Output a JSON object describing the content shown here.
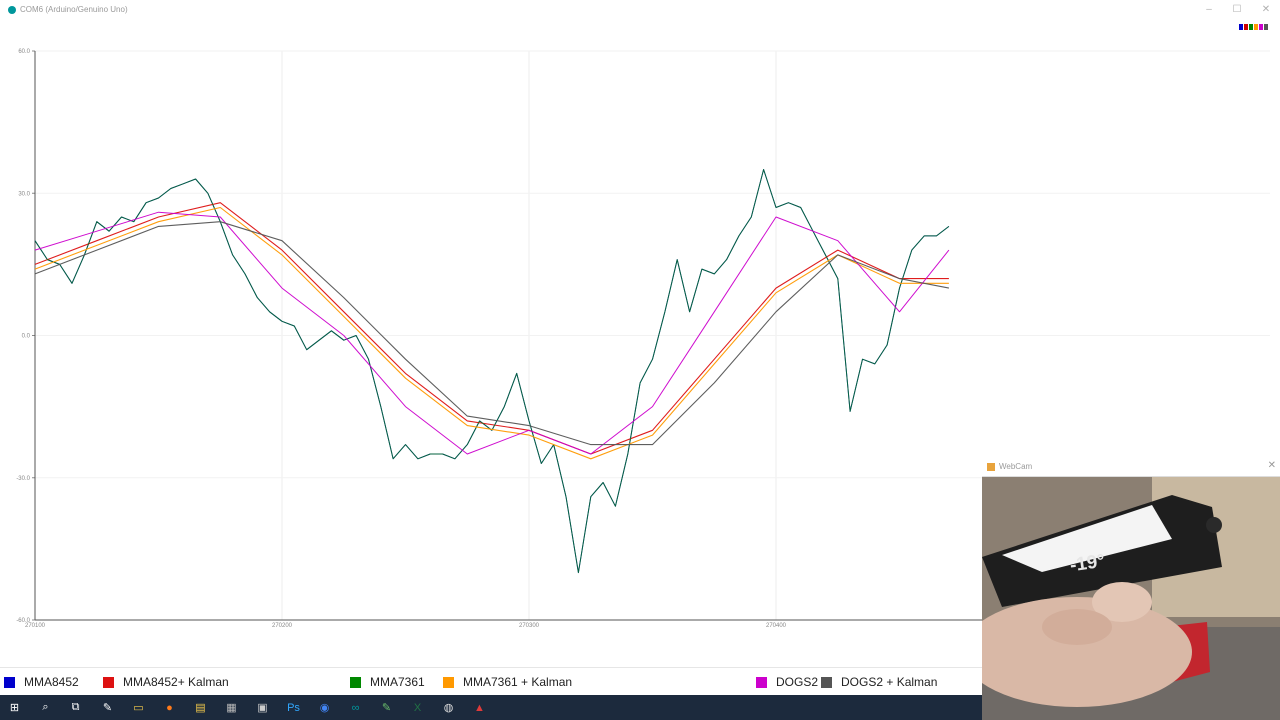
{
  "window": {
    "title": "COM6 (Arduino/Genuino Uno)",
    "controls": [
      "–",
      "☐",
      "✕"
    ]
  },
  "colorbar": [
    "#0000cc",
    "#cc0000",
    "#008800",
    "#ff9900",
    "#cc00cc",
    "#555555"
  ],
  "chart_data": {
    "type": "line",
    "ylim": [
      -60,
      60
    ],
    "y_ticks": [
      "60.0",
      "30.0",
      "0.0",
      "-30.0",
      "-60.0"
    ],
    "x_ticks": [
      "270100",
      "270200",
      "270300",
      "270400"
    ],
    "xlim": [
      270100,
      270600
    ],
    "grid": true,
    "legend_position": "bottom",
    "series": [
      {
        "name": "MMA8452",
        "color": "#0000cc",
        "points": [
          [
            270100,
            20
          ],
          [
            270105,
            16
          ],
          [
            270110,
            15
          ],
          [
            270115,
            11
          ],
          [
            270120,
            17
          ],
          [
            270125,
            24
          ],
          [
            270130,
            22
          ],
          [
            270135,
            25
          ],
          [
            270140,
            24
          ],
          [
            270145,
            28
          ],
          [
            270150,
            29
          ],
          [
            270155,
            31
          ],
          [
            270160,
            32
          ],
          [
            270165,
            33
          ],
          [
            270170,
            30
          ],
          [
            270175,
            24
          ],
          [
            270180,
            17
          ],
          [
            270185,
            13
          ],
          [
            270190,
            8
          ],
          [
            270195,
            5
          ],
          [
            270200,
            3
          ],
          [
            270205,
            2
          ],
          [
            270210,
            -3
          ],
          [
            270215,
            -1
          ],
          [
            270220,
            1
          ],
          [
            270225,
            -1
          ],
          [
            270230,
            0
          ],
          [
            270235,
            -5
          ],
          [
            270240,
            -15
          ],
          [
            270245,
            -26
          ],
          [
            270250,
            -23
          ],
          [
            270255,
            -26
          ],
          [
            270260,
            -25
          ],
          [
            270265,
            -25
          ],
          [
            270270,
            -26
          ],
          [
            270275,
            -23
          ],
          [
            270280,
            -18
          ],
          [
            270285,
            -20
          ],
          [
            270290,
            -15
          ],
          [
            270295,
            -8
          ],
          [
            270300,
            -18
          ],
          [
            270305,
            -27
          ],
          [
            270310,
            -23
          ],
          [
            270315,
            -34
          ],
          [
            270320,
            -50
          ],
          [
            270325,
            -34
          ],
          [
            270330,
            -31
          ],
          [
            270335,
            -36
          ],
          [
            270340,
            -25
          ],
          [
            270345,
            -10
          ],
          [
            270350,
            -5
          ],
          [
            270355,
            5
          ],
          [
            270360,
            16
          ],
          [
            270365,
            5
          ],
          [
            270370,
            14
          ],
          [
            270375,
            13
          ],
          [
            270380,
            16
          ],
          [
            270385,
            21
          ],
          [
            270390,
            25
          ],
          [
            270395,
            35
          ],
          [
            270400,
            27
          ],
          [
            270405,
            28
          ],
          [
            270410,
            27
          ],
          [
            270415,
            22
          ],
          [
            270420,
            17
          ],
          [
            270425,
            12
          ],
          [
            270430,
            -16
          ],
          [
            270435,
            -5
          ],
          [
            270440,
            -6
          ],
          [
            270445,
            -2
          ],
          [
            270450,
            10
          ],
          [
            270455,
            18
          ],
          [
            270460,
            21
          ],
          [
            270465,
            21
          ],
          [
            270470,
            23
          ]
        ]
      },
      {
        "name": "MMA8452+ Kalman",
        "color": "#dd1111",
        "points": [
          [
            270100,
            15
          ],
          [
            270125,
            20
          ],
          [
            270150,
            25
          ],
          [
            270175,
            28
          ],
          [
            270200,
            18
          ],
          [
            270225,
            5
          ],
          [
            270250,
            -8
          ],
          [
            270275,
            -18
          ],
          [
            270300,
            -20
          ],
          [
            270325,
            -25
          ],
          [
            270350,
            -20
          ],
          [
            270375,
            -5
          ],
          [
            270400,
            10
          ],
          [
            270425,
            18
          ],
          [
            270450,
            12
          ],
          [
            270470,
            12
          ]
        ]
      },
      {
        "name": "MMA7361",
        "color": "#008800",
        "points": [
          [
            270100,
            20
          ],
          [
            270105,
            16
          ],
          [
            270110,
            15
          ],
          [
            270115,
            11
          ],
          [
            270120,
            17
          ],
          [
            270125,
            24
          ],
          [
            270130,
            22
          ],
          [
            270135,
            25
          ],
          [
            270140,
            24
          ],
          [
            270145,
            28
          ],
          [
            270150,
            29
          ],
          [
            270155,
            31
          ],
          [
            270160,
            32
          ],
          [
            270165,
            33
          ],
          [
            270170,
            30
          ],
          [
            270175,
            24
          ],
          [
            270180,
            17
          ],
          [
            270185,
            13
          ],
          [
            270190,
            8
          ],
          [
            270195,
            5
          ],
          [
            270200,
            3
          ],
          [
            270205,
            2
          ],
          [
            270210,
            -3
          ],
          [
            270215,
            -1
          ],
          [
            270220,
            1
          ],
          [
            270225,
            -1
          ],
          [
            270230,
            0
          ],
          [
            270235,
            -5
          ],
          [
            270240,
            -15
          ],
          [
            270245,
            -26
          ],
          [
            270250,
            -23
          ],
          [
            270255,
            -26
          ],
          [
            270260,
            -25
          ],
          [
            270265,
            -25
          ],
          [
            270270,
            -26
          ],
          [
            270275,
            -23
          ],
          [
            270280,
            -18
          ],
          [
            270285,
            -20
          ],
          [
            270290,
            -15
          ],
          [
            270295,
            -8
          ],
          [
            270300,
            -18
          ],
          [
            270305,
            -27
          ],
          [
            270310,
            -23
          ],
          [
            270315,
            -34
          ],
          [
            270320,
            -50
          ],
          [
            270325,
            -34
          ],
          [
            270330,
            -31
          ],
          [
            270335,
            -36
          ],
          [
            270340,
            -25
          ],
          [
            270345,
            -10
          ],
          [
            270350,
            -5
          ],
          [
            270355,
            5
          ],
          [
            270360,
            16
          ],
          [
            270365,
            5
          ],
          [
            270370,
            14
          ],
          [
            270375,
            13
          ],
          [
            270380,
            16
          ],
          [
            270385,
            21
          ],
          [
            270390,
            25
          ],
          [
            270395,
            35
          ],
          [
            270400,
            27
          ],
          [
            270405,
            28
          ],
          [
            270410,
            27
          ],
          [
            270415,
            22
          ],
          [
            270420,
            17
          ],
          [
            270425,
            12
          ],
          [
            270430,
            -16
          ],
          [
            270435,
            -5
          ],
          [
            270440,
            -6
          ],
          [
            270445,
            -2
          ],
          [
            270450,
            10
          ],
          [
            270455,
            18
          ],
          [
            270460,
            21
          ],
          [
            270465,
            21
          ],
          [
            270470,
            23
          ]
        ]
      },
      {
        "name": "MMA7361 + Kalman",
        "color": "#ff9900",
        "points": [
          [
            270100,
            14
          ],
          [
            270125,
            19
          ],
          [
            270150,
            24
          ],
          [
            270175,
            27
          ],
          [
            270200,
            17
          ],
          [
            270225,
            4
          ],
          [
            270250,
            -9
          ],
          [
            270275,
            -19
          ],
          [
            270300,
            -21
          ],
          [
            270325,
            -26
          ],
          [
            270350,
            -21
          ],
          [
            270375,
            -6
          ],
          [
            270400,
            9
          ],
          [
            270425,
            17
          ],
          [
            270450,
            11
          ],
          [
            270470,
            11
          ]
        ]
      },
      {
        "name": "DOGS2",
        "color": "#cc00cc",
        "points": [
          [
            270100,
            18
          ],
          [
            270125,
            22
          ],
          [
            270150,
            26
          ],
          [
            270175,
            25
          ],
          [
            270200,
            10
          ],
          [
            270225,
            0
          ],
          [
            270250,
            -15
          ],
          [
            270275,
            -25
          ],
          [
            270300,
            -20
          ],
          [
            270325,
            -25
          ],
          [
            270350,
            -15
          ],
          [
            270375,
            5
          ],
          [
            270400,
            25
          ],
          [
            270425,
            20
          ],
          [
            270450,
            5
          ],
          [
            270470,
            18
          ]
        ]
      },
      {
        "name": "DOGS2 + Kalman",
        "color": "#555555",
        "points": [
          [
            270100,
            13
          ],
          [
            270125,
            18
          ],
          [
            270150,
            23
          ],
          [
            270175,
            24
          ],
          [
            270200,
            20
          ],
          [
            270225,
            8
          ],
          [
            270250,
            -5
          ],
          [
            270275,
            -17
          ],
          [
            270300,
            -19
          ],
          [
            270325,
            -23
          ],
          [
            270350,
            -23
          ],
          [
            270375,
            -10
          ],
          [
            270400,
            5
          ],
          [
            270425,
            17
          ],
          [
            270450,
            12
          ],
          [
            270470,
            10
          ]
        ]
      }
    ]
  },
  "legend": [
    {
      "label": "MMA8452",
      "color": "#0000cc"
    },
    {
      "label": "MMA8452+ Kalman",
      "color": "#dd1111"
    },
    {
      "label": "MMA7361",
      "color": "#008800"
    },
    {
      "label": "MMA7361 + Kalman",
      "color": "#ff9900"
    },
    {
      "label": "DOGS2",
      "color": "#cc00cc"
    },
    {
      "label": "DOGS2 + Kalman",
      "color": "#555555"
    }
  ],
  "webcam": {
    "title": "WebCam",
    "close": "✕",
    "angle": "-19°"
  },
  "taskbar": {
    "icons": [
      "windows-start-icon",
      "search-icon",
      "task-view-icon",
      "feather-icon",
      "file-explorer-icon",
      "firefox-icon",
      "sticky-notes-icon",
      "calculator-icon",
      "film-icon",
      "photoshop-icon",
      "chrome-icon",
      "arduino-icon",
      "notepad-icon",
      "excel-icon",
      "obs-icon",
      "pdf-icon"
    ],
    "glyphs": [
      "⊞",
      "⌕",
      "⧉",
      "✎",
      "▭",
      "●",
      "▤",
      "▦",
      "▣",
      "Ps",
      "◉",
      "∞",
      "✎",
      "X",
      "◍",
      "▲"
    ],
    "colors": [
      "#ffffff",
      "#ffffff",
      "#ffffff",
      "#ffffff",
      "#f2c94c",
      "#ff7a1a",
      "#f2c94c",
      "#bbbbbb",
      "#cccccc",
      "#31a8ff",
      "#4285f4",
      "#00979c",
      "#6cbf6c",
      "#217346",
      "#dddddd",
      "#e03a3a"
    ]
  }
}
